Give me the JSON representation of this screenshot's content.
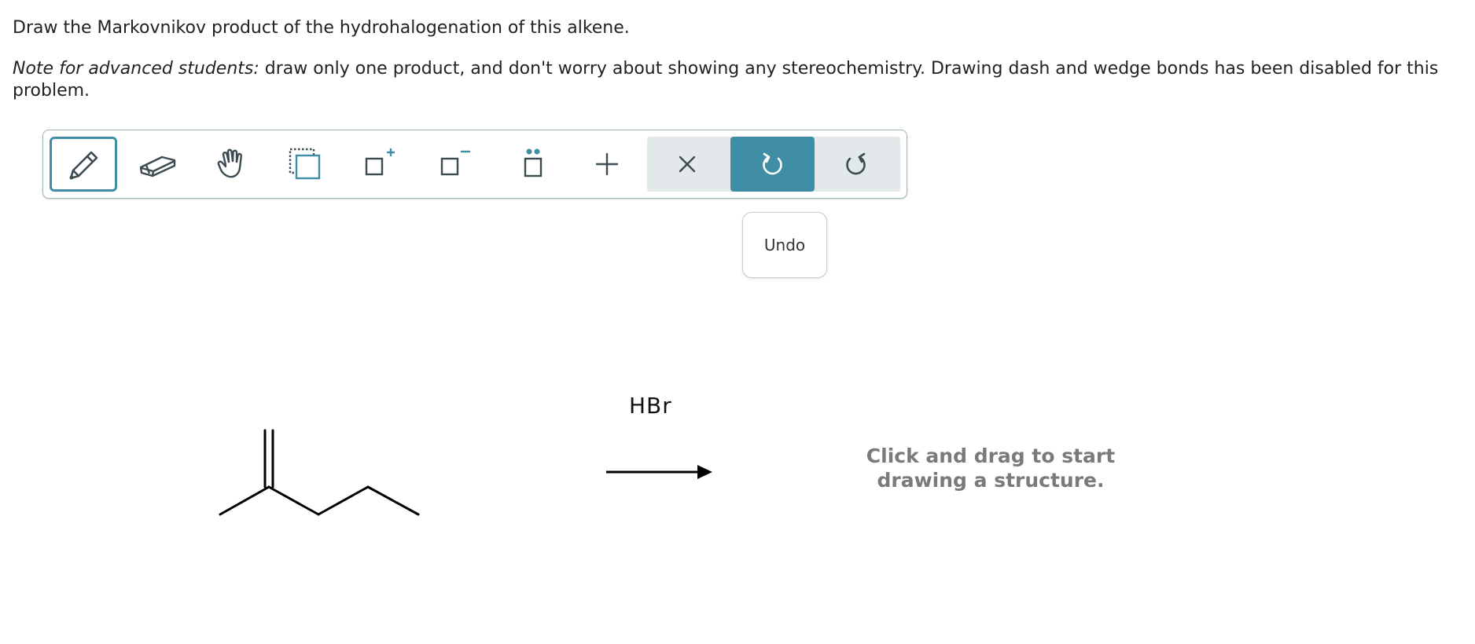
{
  "question": {
    "prompt": "Draw the Markovnikov product of the hydrohalogenation of this alkene.",
    "note_label": "Note for advanced students:",
    "note_text": " draw only one product, and don't worry about showing any stereochemistry. Drawing dash and wedge bonds has been disabled for this problem."
  },
  "toolbar": {
    "tools": [
      {
        "name": "pencil-icon",
        "selected": true
      },
      {
        "name": "eraser-icon"
      },
      {
        "name": "hand-icon"
      },
      {
        "name": "select-box-icon"
      },
      {
        "name": "positive-charge-icon"
      },
      {
        "name": "negative-charge-icon"
      },
      {
        "name": "lone-pair-icon"
      },
      {
        "name": "plus-icon"
      },
      {
        "name": "close-icon"
      },
      {
        "name": "undo-icon",
        "active": true
      },
      {
        "name": "redo-icon"
      }
    ],
    "accent_color": "#3f8ea5",
    "group_bg_color": "#e3e8ea"
  },
  "tooltip": {
    "label": "Undo"
  },
  "reaction": {
    "reagent": "HBr"
  },
  "canvas": {
    "hint_line1": "Click and drag to start",
    "hint_line2": "drawing a structure."
  }
}
